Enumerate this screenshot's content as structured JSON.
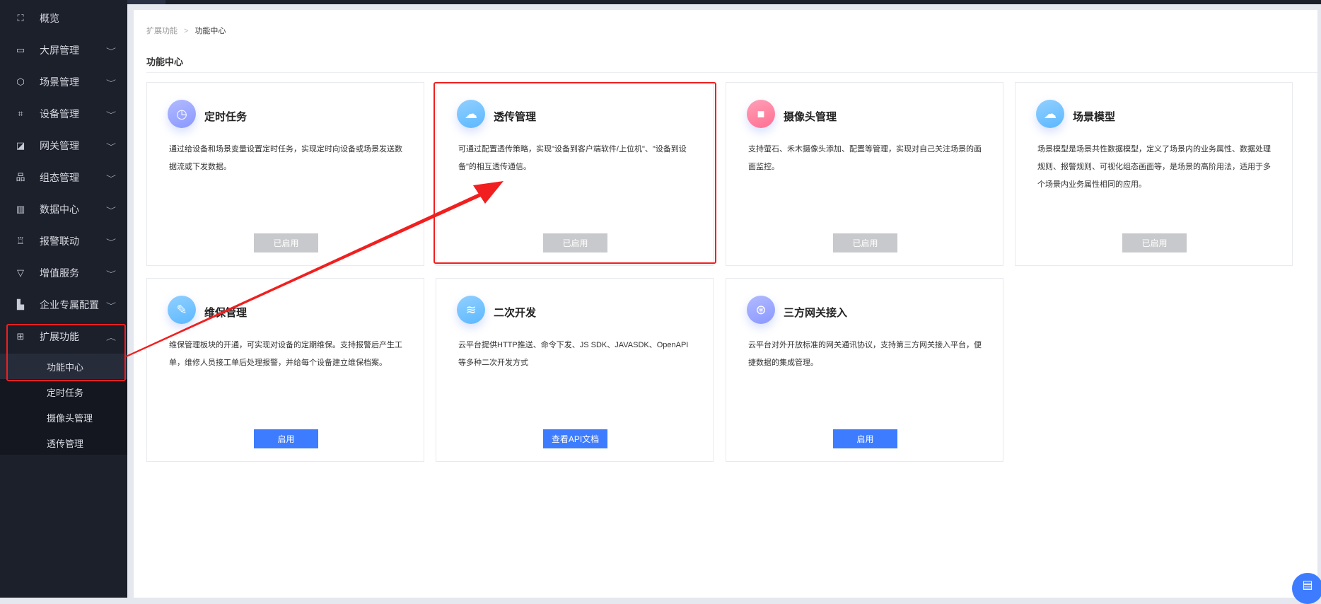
{
  "sidebar": {
    "items": [
      {
        "label": "概览",
        "icon": "overview-icon",
        "glyph": "⛶"
      },
      {
        "label": "大屏管理",
        "icon": "monitor-icon",
        "glyph": "▭"
      },
      {
        "label": "场景管理",
        "icon": "cube-icon",
        "glyph": "⬡"
      },
      {
        "label": "设备管理",
        "icon": "device-icon",
        "glyph": "⌗"
      },
      {
        "label": "网关管理",
        "icon": "gateway-icon",
        "glyph": "◪"
      },
      {
        "label": "组态管理",
        "icon": "topology-icon",
        "glyph": "品"
      },
      {
        "label": "数据中心",
        "icon": "chart-icon",
        "glyph": "▥"
      },
      {
        "label": "报警联动",
        "icon": "alarm-icon",
        "glyph": "♖"
      },
      {
        "label": "增值服务",
        "icon": "diamond-icon",
        "glyph": "▽"
      },
      {
        "label": "企业专属配置",
        "icon": "building-icon",
        "glyph": "▙"
      },
      {
        "label": "扩展功能",
        "icon": "grid-icon",
        "glyph": "⊞"
      }
    ],
    "chevron_down": "﹀",
    "chevron_up": "︿",
    "submenu": [
      "功能中心",
      "定时任务",
      "摄像头管理",
      "透传管理"
    ]
  },
  "breadcrumb": {
    "parent": "扩展功能",
    "separator": ">",
    "current": "功能中心"
  },
  "page_title": "功能中心",
  "cards": [
    {
      "title": "定时任务",
      "desc": "通过给设备和场景变量设置定时任务，实现定时向设备或场景发送数据流或下发数据。",
      "button": "已启用",
      "enabled": true,
      "icon": "clock-icon",
      "glyph": "◷",
      "color": "#8a98ff"
    },
    {
      "title": "透传管理",
      "desc": "可通过配置透传策略，实现\"设备到客户端软件/上位机\"、\"设备到设备\"的相互透传通信。",
      "button": "已启用",
      "enabled": true,
      "icon": "cloud-transfer-icon",
      "glyph": "☁",
      "color": "#5bb8ff"
    },
    {
      "title": "摄像头管理",
      "desc": "支持萤石、禾木摄像头添加、配置等管理，实现对自己关注场景的画面监控。",
      "button": "已启用",
      "enabled": true,
      "icon": "camera-icon",
      "glyph": "■",
      "color": "#ff6f92"
    },
    {
      "title": "场景模型",
      "desc": "场景模型是场景共性数据模型，定义了场景内的业务属性、数据处理规则、报警规则、可视化组态画面等，是场景的高阶用法，适用于多个场景内业务属性相同的应用。",
      "button": "已启用",
      "enabled": true,
      "icon": "cloud-model-icon",
      "glyph": "☁",
      "color": "#5bb8ff"
    },
    {
      "title": "维保管理",
      "desc": "维保管理板块的开通，可实现对设备的定期维保。支持报警后产生工单，维修人员接工单后处理报警，并给每个设备建立维保档案。",
      "button": "启用",
      "enabled": false,
      "icon": "wrench-icon",
      "glyph": "✎",
      "color": "#5bb8ff"
    },
    {
      "title": "二次开发",
      "desc": "云平台提供HTTP推送、命令下发、JS SDK、JAVASDK、OpenAPI等多种二次开发方式",
      "button": "查看API文档",
      "enabled": false,
      "icon": "layers-icon",
      "glyph": "≋",
      "color": "#5bb8ff"
    },
    {
      "title": "三方网关接入",
      "desc": "云平台对外开放标准的网关通讯协议，支持第三方网关接入平台，便捷数据的集成管理。",
      "button": "启用",
      "enabled": false,
      "icon": "network-icon",
      "glyph": "⊛",
      "color": "#8a98ff"
    }
  ],
  "fab": {
    "icon": "document-icon",
    "glyph": "▤"
  }
}
